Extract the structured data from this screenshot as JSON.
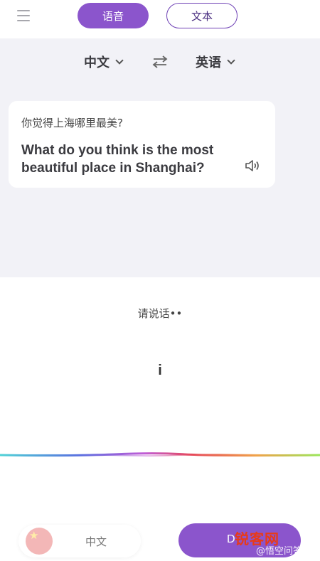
{
  "header": {
    "tabs": [
      {
        "label": "语音",
        "active": true
      },
      {
        "label": "文本",
        "active": false
      }
    ]
  },
  "languages": {
    "source": "中文",
    "target": "英语"
  },
  "translation_card": {
    "source_text": "你觉得上海哪里最美?",
    "translated_text": "What do you think is the most beautiful place in Shanghai?"
  },
  "listening": {
    "prompt": "请说话••",
    "recognized": "i"
  },
  "bottom": {
    "left_language": "中文",
    "right_language": "D"
  },
  "watermark": {
    "logo": "锐客网",
    "sub": "@悟空问答"
  },
  "colors": {
    "accent": "#8b55cc",
    "background_grey": "#f2f2f7"
  },
  "icons": [
    "menu-icon",
    "swap-icon",
    "speaker-icon",
    "china-flag-icon"
  ]
}
